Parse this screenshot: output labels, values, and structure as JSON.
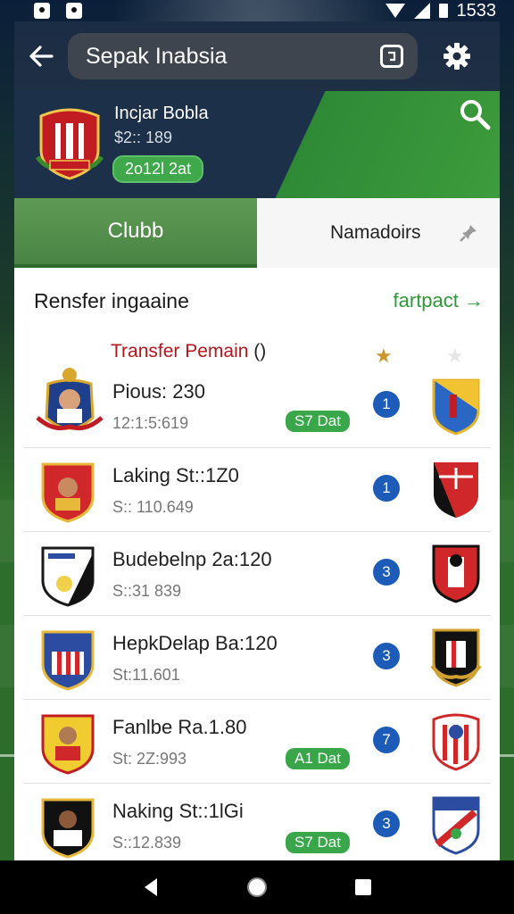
{
  "status": {
    "time": "1533"
  },
  "search": {
    "value": "Sepak Inabsia",
    "icon_label": "←"
  },
  "league": {
    "name": "Incjar Bobla",
    "price": "$2:: 189",
    "badge": "2o12l 2at"
  },
  "tabs": [
    {
      "label": "Clubb",
      "active": true
    },
    {
      "label": "Namadoirs",
      "active": false
    }
  ],
  "section": {
    "title": "Rensfer ingaaine",
    "link": "fartpact →"
  },
  "featured": {
    "headline": "Transfer Pemain",
    "headline_suffix": "()"
  },
  "rows": [
    {
      "title": "Pious: 230",
      "sub": "12:1:5:619",
      "tag": "S7 Dat",
      "num": "1"
    },
    {
      "title": "Laking St::1Z0",
      "sub": "S:: 110.649",
      "tag": "",
      "num": "1"
    },
    {
      "title": "Budebelnp 2a:120",
      "sub": "S::31 839",
      "tag": "",
      "num": "3"
    },
    {
      "title": "HepkDelap Ba:120",
      "sub": "St:11.601",
      "tag": "",
      "num": "3"
    },
    {
      "title": "Fanlbe Ra.1.80",
      "sub": "St: 2Z:993",
      "tag": "A1 Dat",
      "num": "7"
    },
    {
      "title": "Naking St::1lGi",
      "sub": "S::12.839",
      "tag": "S7 Dat",
      "num": "3"
    }
  ],
  "colors": {
    "accent": "#3aa64a",
    "header": "#1c3049",
    "number": "#1c5bb8"
  },
  "icons": [
    "back-arrow-icon",
    "app-switch-icon",
    "gear-icon",
    "search-icon",
    "pin-icon",
    "star-icon"
  ]
}
